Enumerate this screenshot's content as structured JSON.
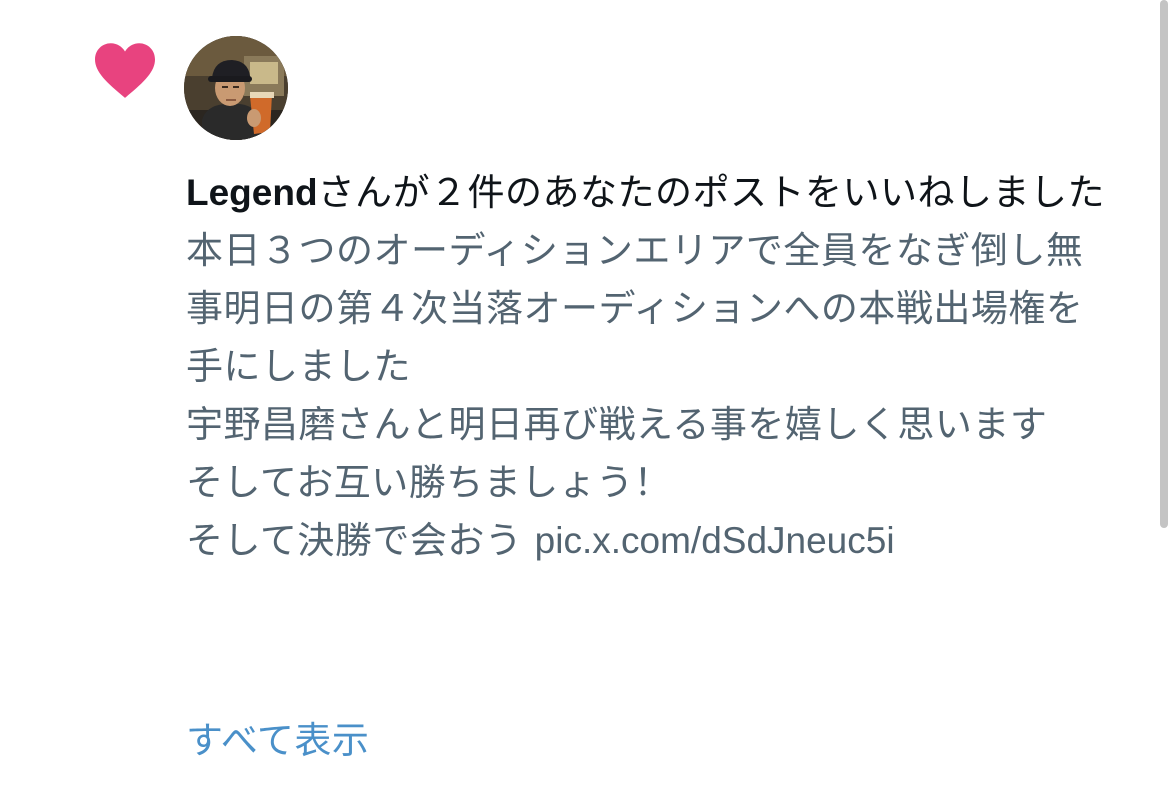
{
  "notification": {
    "icon": "heart-icon",
    "icon_color": "#e8437f",
    "username": "Legend",
    "action_text": "さんが２件のあなたのポストをいいねしました",
    "post_lines": [
      "本日３つのオーディションエリアで全員をなぎ倒し無事明日の第４次当落オーディションへの本戦出場権を手にしました",
      "宇野昌磨さんと明日再び戦える事を嬉しく思います",
      "そしてお互い勝ちましょう！",
      "そして決勝で会おう"
    ],
    "post_link": "pic.x.com/dSdJneuc5i",
    "show_all_label": "すべて表示",
    "link_color": "#4a90c9",
    "text_color": "#536471"
  }
}
